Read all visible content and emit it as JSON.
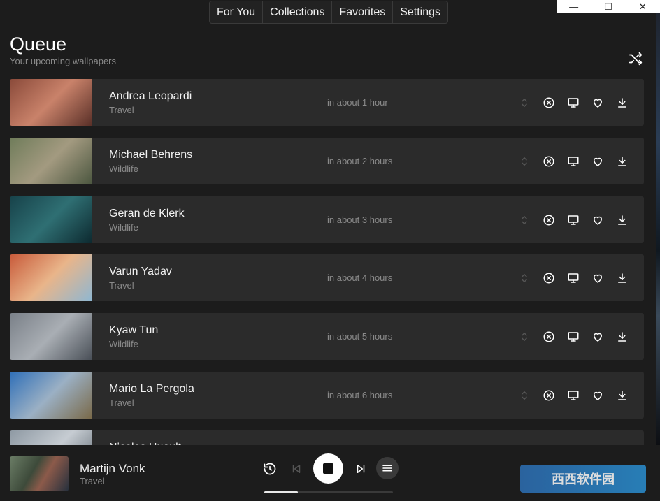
{
  "window": {
    "minimize": "—",
    "maximize": "☐",
    "close": "✕"
  },
  "nav": {
    "tabs": [
      "For You",
      "Collections",
      "Favorites",
      "Settings"
    ]
  },
  "page": {
    "title": "Queue",
    "subtitle": "Your upcoming wallpapers"
  },
  "queue": [
    {
      "author": "Andrea Leopardi",
      "category": "Travel",
      "eta": "in about 1 hour",
      "thumb_colors": [
        "#8a4a3a",
        "#c9826a",
        "#5a3028"
      ]
    },
    {
      "author": "Michael Behrens",
      "category": "Wildlife",
      "eta": "in about 2 hours",
      "thumb_colors": [
        "#6f7c5a",
        "#a39a80",
        "#4c5740"
      ]
    },
    {
      "author": "Geran de Klerk",
      "category": "Wildlife",
      "eta": "in about 3 hours",
      "thumb_colors": [
        "#17424a",
        "#2f6f73",
        "#0d2a30"
      ]
    },
    {
      "author": "Varun Yadav",
      "category": "Travel",
      "eta": "in about 4 hours",
      "thumb_colors": [
        "#c85a3a",
        "#e9b58a",
        "#8fb7d1"
      ]
    },
    {
      "author": "Kyaw Tun",
      "category": "Wildlife",
      "eta": "in about 5 hours",
      "thumb_colors": [
        "#7a8088",
        "#a9aeb4",
        "#4a5058"
      ]
    },
    {
      "author": "Mario La Pergola",
      "category": "Travel",
      "eta": "in about 6 hours",
      "thumb_colors": [
        "#2f6fb8",
        "#9bb0c4",
        "#7a6a4a"
      ]
    },
    {
      "author": "Nicolas Huault",
      "category": "",
      "eta": "",
      "thumb_colors": [
        "#8e99a3",
        "#c6ccd2",
        "#5a646d"
      ]
    }
  ],
  "player": {
    "author": "Martijn Vonk",
    "category": "Travel",
    "progress": 0.26
  },
  "watermark": "西西软件园"
}
